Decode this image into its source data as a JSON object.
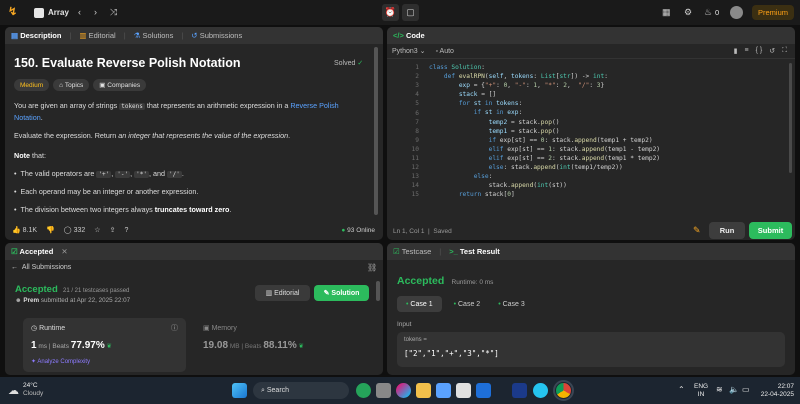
{
  "topbar": {
    "problem_list": "Array",
    "premium": "Premium",
    "streak": "0"
  },
  "description_panel": {
    "tabs": [
      "Description",
      "Editorial",
      "Solutions",
      "Submissions"
    ],
    "title": "150. Evaluate Reverse Polish Notation",
    "status": "Solved",
    "tags": [
      "Medium",
      "Topics",
      "Companies"
    ],
    "p1_before": "You are given an array of strings ",
    "p1_code": "tokens",
    "p1_after": " that represents an arithmetic expression in a ",
    "p1_link": "Reverse Polish Notation",
    "p1_end": ".",
    "p2_before": "Evaluate the expression. Return ",
    "p2_em": "an integer that represents the value of the expression",
    "p2_end": ".",
    "note": "Note",
    "note_after": " that:",
    "b1_before": "The valid operators are ",
    "b1_ops": [
      "'+'",
      "'-'",
      "'*'",
      "'/'"
    ],
    "b1_and": " and ",
    "b1_end": ".",
    "b2": "Each operand may be an integer or another expression.",
    "b3_before": "The division between two integers always ",
    "b3_bold": "truncates toward zero",
    "b3_end": ".",
    "likes": "8.1K",
    "comments": "332",
    "online": "93 Online"
  },
  "code_panel": {
    "title": "Code",
    "language": "Python3",
    "auto": "Auto",
    "status": "Ln 1, Col 1",
    "saved": "Saved",
    "run": "Run",
    "submit": "Submit",
    "line_numbers": [
      "1",
      "2",
      "3",
      "4",
      "5",
      "6",
      "7",
      "8",
      "9",
      "10",
      "11",
      "12",
      "13",
      "14",
      "15"
    ]
  },
  "accepted_panel": {
    "tab": "Accepted",
    "back": "All Submissions",
    "result": "Accepted",
    "passed": "21 / 21 testcases passed",
    "user": "Prem",
    "submitted": "submitted at Apr 22, 2025 22:07",
    "editorial": "Editorial",
    "solution": "Solution",
    "runtime_label": "Runtime",
    "runtime_value": "1",
    "runtime_unit": "ms",
    "beats": "Beats",
    "runtime_pct": "77.97%",
    "analyze": "Analyze Complexity",
    "memory_label": "Memory",
    "memory_value": "19.08",
    "memory_unit": "MB",
    "memory_pct": "88.11%"
  },
  "test_panel": {
    "tabs": [
      "Testcase",
      "Test Result"
    ],
    "result": "Accepted",
    "runtime": "Runtime: 0 ms",
    "cases": [
      "Case 1",
      "Case 2",
      "Case 3"
    ],
    "input_label": "Input",
    "var": "tokens =",
    "value": "[\"2\",\"1\",\"+\",\"3\",\"*\"]"
  },
  "taskbar": {
    "temp": "24°C",
    "weather": "Cloudy",
    "search": "Search",
    "lang1": "ENG",
    "lang2": "IN",
    "time": "22:07",
    "date": "22-04-2025"
  }
}
